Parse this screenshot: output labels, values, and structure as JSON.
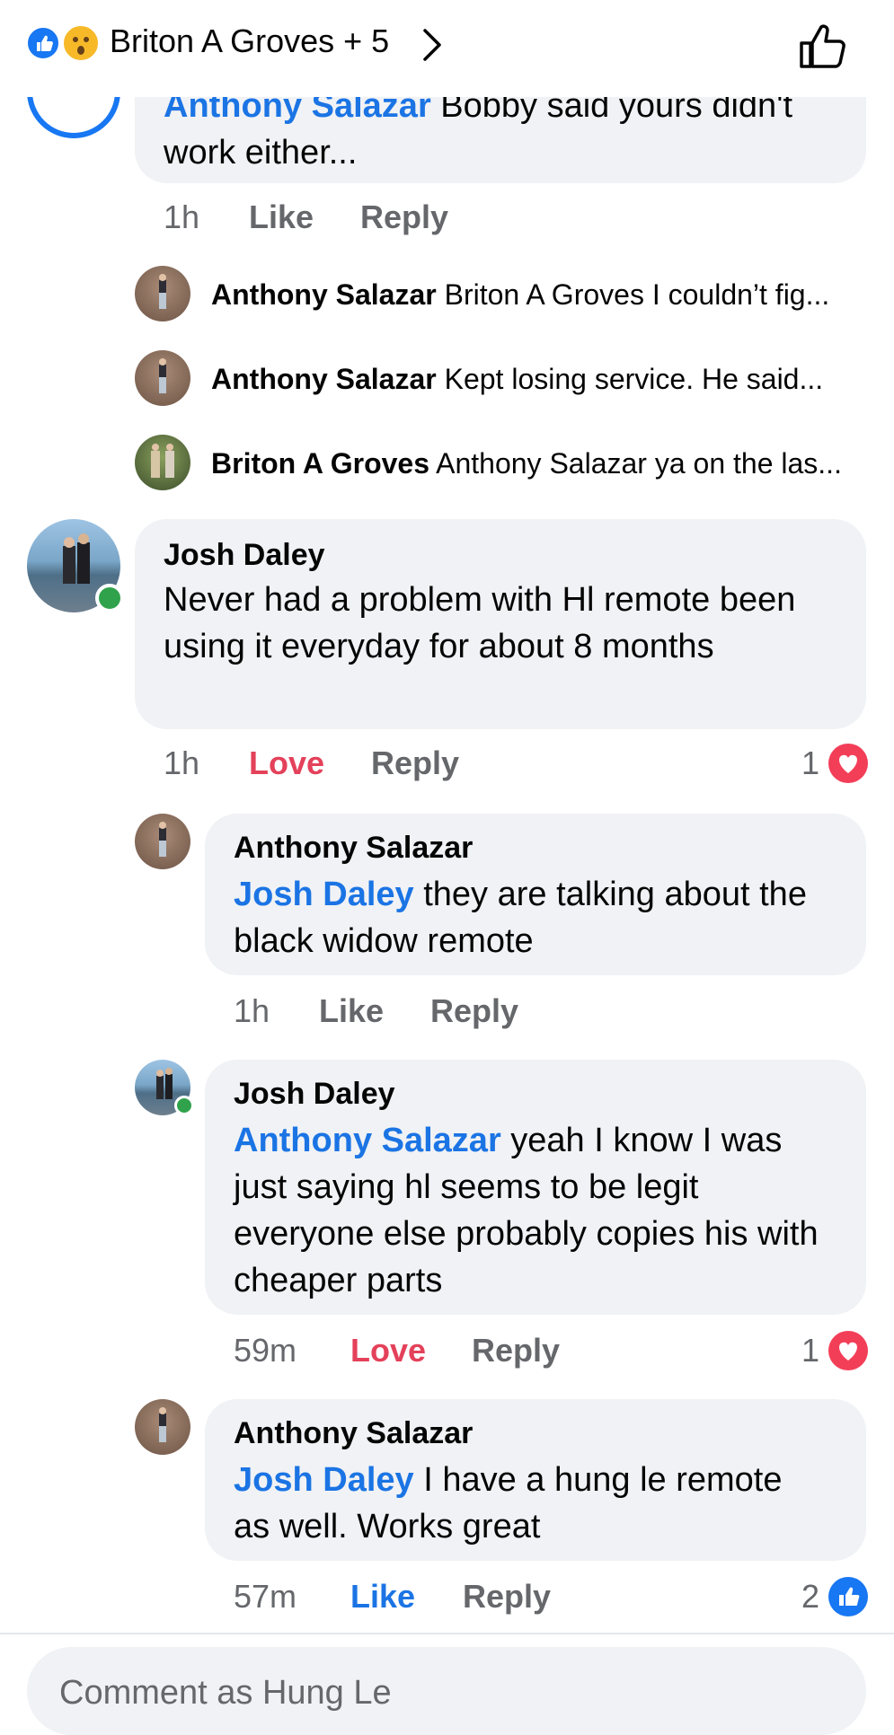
{
  "header": {
    "title": "Briton A Groves + 5",
    "reactions": [
      "like-icon",
      "wow-icon"
    ],
    "like_icon": "thumbs-up-outline-icon"
  },
  "comments": {
    "top_partial": {
      "name": "Anthony Salazar",
      "text_partial": "Bobby said yours didn't",
      "text_line2": "work either...",
      "time": "1h",
      "like": "Like",
      "reply": "Reply"
    },
    "collapsed_replies": [
      {
        "name": "Anthony Salazar",
        "text": "Briton A Groves I couldn’t fig..."
      },
      {
        "name": "Anthony Salazar",
        "text": "Kept losing service. He said..."
      },
      {
        "name": "Briton A Groves",
        "text": "Anthony Salazar ya on the las..."
      }
    ],
    "josh": {
      "name": "Josh Daley",
      "text": "Never had a problem with Hl remote been using it everyday for about 8 months",
      "time": "1h",
      "reaction_label": "Love",
      "reply": "Reply",
      "reaction_count": "1"
    },
    "replies": [
      {
        "name": "Anthony Salazar",
        "mention": "Josh Daley",
        "text": " they are talking about the black widow remote",
        "time": "1h",
        "reaction_label": "Like",
        "reply": "Reply"
      },
      {
        "name": "Josh Daley",
        "mention": "Anthony Salazar",
        "text": " yeah I know I was just saying hl seems to be legit everyone else probably copies his with cheaper parts",
        "time": "59m",
        "reaction_label": "Love",
        "reply": "Reply",
        "reaction_count": "1"
      },
      {
        "name": "Anthony Salazar",
        "mention": "Josh Daley",
        "text": " I have a hung le remote as well. Works great",
        "time": "57m",
        "reaction_label": "Like",
        "reply": "Reply",
        "reaction_count": "2"
      }
    ]
  },
  "composer": {
    "placeholder": "Comment as Hung Le"
  },
  "colors": {
    "bubble": "#f0f2f5",
    "link": "#1b74e4",
    "love": "#e4415a",
    "meta": "#65676b",
    "online": "#31a24c"
  }
}
